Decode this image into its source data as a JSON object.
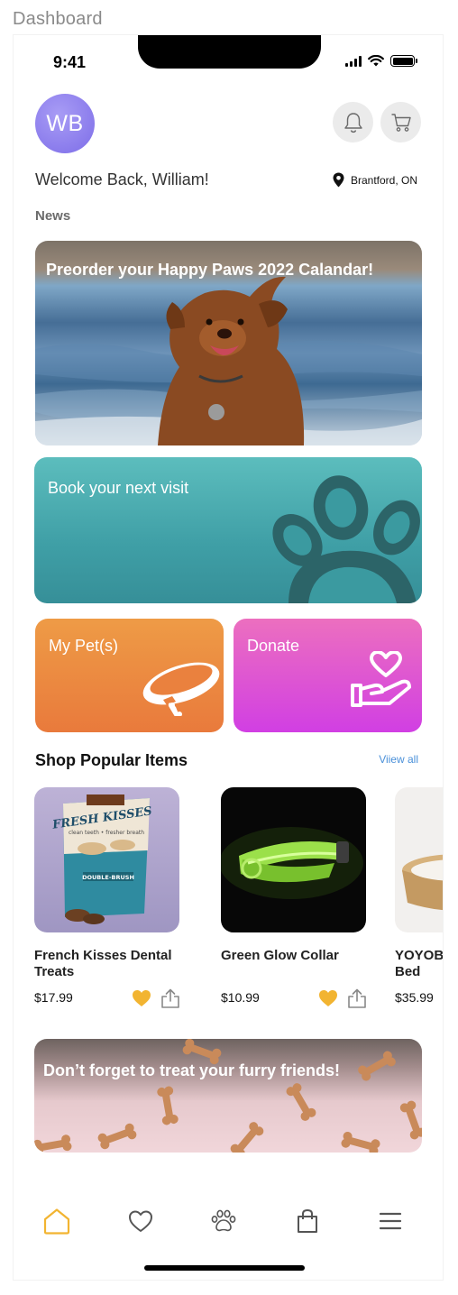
{
  "frame_label": "Dashboard",
  "status_bar": {
    "time": "9:41"
  },
  "header": {
    "avatar_initials": "WB",
    "welcome": "Welcome Back, William!",
    "location": "Brantford, ON"
  },
  "news": {
    "section_title": "News",
    "headline": "Preorder your Happy Paws 2022 Calandar!"
  },
  "cards": {
    "visit": "Book your next visit",
    "pets": "My Pet(s)",
    "donate": "Donate"
  },
  "shop": {
    "title": "Shop Popular Items",
    "view_all": "Viiew all",
    "items": [
      {
        "name": "French Kisses Dental Treats",
        "price": "$17.99",
        "favorited": true
      },
      {
        "name": "Green Glow Collar",
        "price": "$10.99",
        "favorited": true
      },
      {
        "name": "YOYOB Bed",
        "price": "$35.99"
      }
    ],
    "package_text": {
      "brand": "FRESH KISSES",
      "tagline": "clean teeth • fresher breath",
      "variant": "DOUBLE-BRUSH"
    }
  },
  "promo": {
    "treat_text": "Don’t forget to treat your furry friends!"
  },
  "tabbar": [
    "home-icon",
    "heart-icon",
    "paw-icon",
    "bag-icon",
    "menu-icon"
  ],
  "colors": {
    "accent": "#f2b431",
    "avatar": "#8f7ff0",
    "visit_card": "#4aaeb2",
    "pets_card": "#ec8a40",
    "donate_card": "#e055d0",
    "link": "#4a90d9"
  }
}
